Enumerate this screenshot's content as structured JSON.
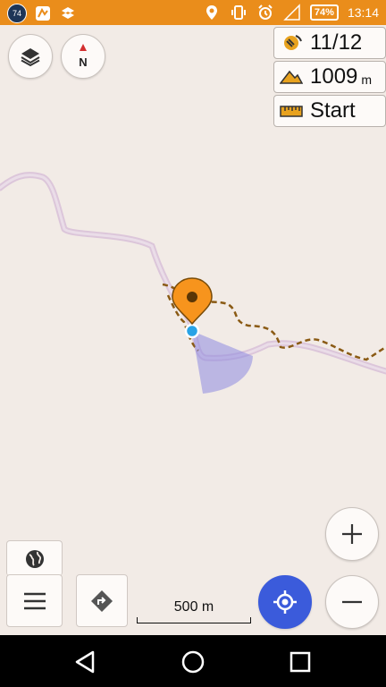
{
  "status_bar": {
    "notification_badge": "74",
    "battery_percent": "74%",
    "time": "13:14",
    "icons": [
      "notification-badge-icon",
      "map-app-icon",
      "dropbox-icon",
      "location-icon",
      "vibrate-icon",
      "alarm-icon",
      "signal-icon",
      "battery-icon"
    ]
  },
  "widgets": {
    "gps": {
      "value": "11/12",
      "icon": "satellite-icon"
    },
    "altitude": {
      "value": "1009",
      "unit": "m",
      "icon": "mountain-icon"
    },
    "ruler": {
      "value": "Start",
      "icon": "ruler-icon"
    }
  },
  "map_controls": {
    "layers_icon": "layers-icon",
    "compass_label": "N",
    "globe_icon": "globe-icon",
    "menu_icon": "hamburger-menu-icon",
    "directions_icon": "directions-icon",
    "location_icon": "my-location-icon",
    "zoom_in_icon": "plus-icon",
    "zoom_out_icon": "minus-icon"
  },
  "scale": {
    "label": "500 m"
  },
  "colors": {
    "status_bar": "#ea8d1b",
    "map_background": "#f2ebe6",
    "route_track": "#8a5a14",
    "road": "#d9c4d6",
    "marker": "#f7941d",
    "location_button": "#3b5bdb",
    "heading_cone": "#8e8ae0"
  }
}
